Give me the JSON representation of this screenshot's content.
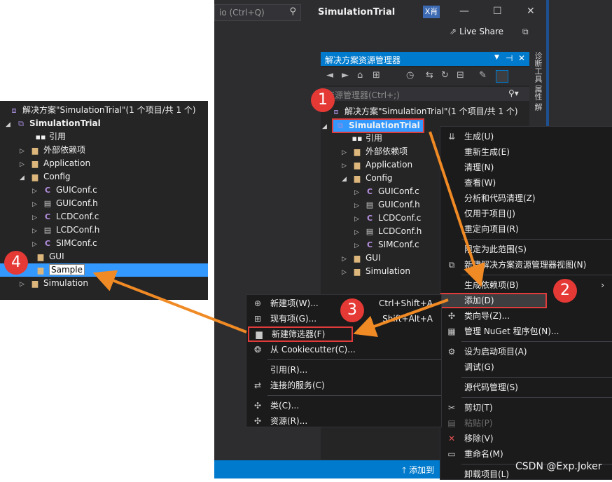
{
  "vs": {
    "search_text": "io (Ctrl+Q)",
    "project_title": "SimulationTrial",
    "account_initials": "X肖",
    "live_share": "Live Share",
    "status_text": "添加到"
  },
  "explorer": {
    "title": "解决方案资源管理器",
    "search_placeholder": "资源管理器(Ctrl+;)",
    "solution_label": "解决方案\"SimulationTrial\"(1 个项目/共 1 个)",
    "project_label": "SimulationTrial",
    "items": [
      "引用",
      "外部依赖项",
      "Application",
      "Config",
      "GUIConf.c",
      "GUIConf.h",
      "LCDConf.c",
      "LCDConf.h",
      "SIMConf.c",
      "GUI",
      "Simulation"
    ]
  },
  "side_tabs": "诊断工具 属性 解",
  "left_panel": {
    "solution_label": "解决方案\"SimulationTrial\"(1 个项目/共 1 个)",
    "project_label": "SimulationTrial",
    "items": [
      "引用",
      "外部依赖项",
      "Application",
      "Config",
      "GUIConf.c",
      "GUIConf.h",
      "LCDConf.c",
      "LCDConf.h",
      "SIMConf.c",
      "GUI",
      "Sample",
      "Simulation"
    ]
  },
  "context_menu": {
    "items": [
      "生成(U)",
      "重新生成(E)",
      "清理(N)",
      "查看(W)",
      "分析和代码清理(Z)",
      "仅用于项目(J)",
      "重定向项目(R)",
      "限定为此范围(S)",
      "新建解决方案资源管理器视图(N)",
      "生成依赖项(B)",
      "添加(D)",
      "类向导(Z)...",
      "管理 NuGet 程序包(N)...",
      "设为启动项目(A)",
      "调试(G)",
      "源代码管理(S)",
      "剪切(T)",
      "粘贴(P)",
      "移除(V)",
      "重命名(M)",
      "卸载项目(L)"
    ]
  },
  "add_submenu": {
    "items": [
      "新建项(W)...",
      "现有项(G)...",
      "新建筛选器(F)",
      "从 Cookiecutter(C)...",
      "引用(R)...",
      "连接的服务(C)",
      "类(C)...",
      "资源(R)..."
    ],
    "shortcuts": [
      "Ctrl+Shift+A",
      "Shift+Alt+A"
    ]
  },
  "badges": [
    "1",
    "2",
    "3",
    "4"
  ],
  "watermark": "CSDN @Exp.Joker",
  "colors": {
    "accent": "#007acc",
    "selection": "#3399ff",
    "highlight_box": "#e03b3b",
    "arrow": "#f08a24",
    "badge": "#e53935"
  }
}
